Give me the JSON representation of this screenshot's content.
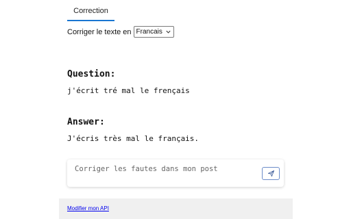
{
  "tabs": [
    {
      "label": "Correction",
      "active": true
    }
  ],
  "language": {
    "label": "Corriger le texte en",
    "selected": "Francais"
  },
  "qa": {
    "question_heading": "Question:",
    "question_text": "j'écrit tré mal le frençais",
    "answer_heading": "Answer:",
    "answer_text": "J'écris très mal le français."
  },
  "composer": {
    "placeholder": "Corriger les fautes dans mon post",
    "send_icon": "send-icon"
  },
  "footer": {
    "link": "Modifier mon API"
  },
  "colors": {
    "accent": "#1976d2",
    "footer_bg": "#f0f0f0",
    "link": "#0000ee"
  }
}
